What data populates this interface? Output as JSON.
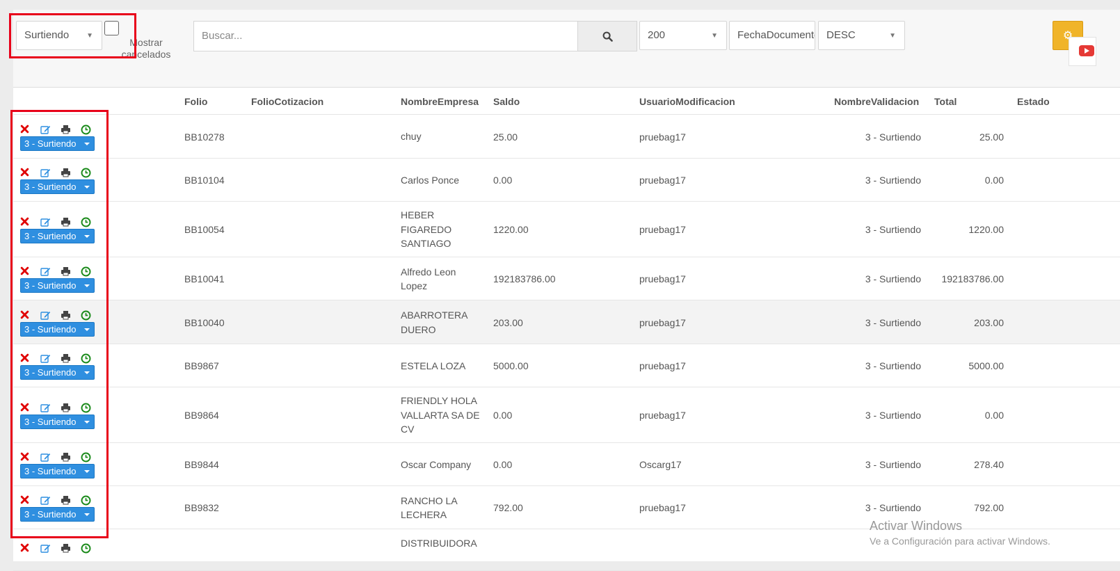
{
  "toolbar": {
    "status_filter": "Surtiendo",
    "show_canceled_line1": "Mostrar",
    "show_canceled_line2": "cancelados",
    "search_placeholder": "Buscar...",
    "page_size": "200",
    "sort_field": "FechaDocumento",
    "sort_order": "DESC"
  },
  "columns": {
    "folio": "Folio",
    "folio_cotizacion": "FolioCotizacion",
    "nombre_empresa": "NombreEmpresa",
    "saldo": "Saldo",
    "usuario": "UsuarioModificacion",
    "validacion": "NombreValidacion",
    "total": "Total",
    "estado": "Estado"
  },
  "rows": [
    {
      "status": "3 - Surtiendo",
      "folio": "BB10278",
      "empresa": [
        "chuy"
      ],
      "saldo": "25.00",
      "usuario": "pruebag17",
      "validacion": "3 - Surtiendo",
      "total": "25.00"
    },
    {
      "status": "3 - Surtiendo",
      "folio": "BB10104",
      "empresa": [
        "Carlos Ponce"
      ],
      "saldo": "0.00",
      "usuario": "pruebag17",
      "validacion": "3 - Surtiendo",
      "total": "0.00"
    },
    {
      "status": "3 - Surtiendo",
      "folio": "BB10054",
      "empresa": [
        "HEBER",
        "FIGAREDO",
        "SANTIAGO"
      ],
      "saldo": "1220.00",
      "usuario": "pruebag17",
      "validacion": "3 - Surtiendo",
      "total": "1220.00"
    },
    {
      "status": "3 - Surtiendo",
      "folio": "BB10041",
      "empresa": [
        "Alfredo Leon",
        "Lopez"
      ],
      "saldo": "192183786.00",
      "usuario": "pruebag17",
      "validacion": "3 - Surtiendo",
      "total": "192183786.00"
    },
    {
      "status": "3 - Surtiendo",
      "folio": "BB10040",
      "empresa": [
        "ABARROTERA",
        "DUERO"
      ],
      "saldo": "203.00",
      "usuario": "pruebag17",
      "validacion": "3 - Surtiendo",
      "total": "203.00"
    },
    {
      "status": "3 - Surtiendo",
      "folio": "BB9867",
      "empresa": [
        "ESTELA LOZA"
      ],
      "saldo": "5000.00",
      "usuario": "pruebag17",
      "validacion": "3 - Surtiendo",
      "total": "5000.00"
    },
    {
      "status": "3 - Surtiendo",
      "folio": "BB9864",
      "empresa": [
        "FRIENDLY HOLA",
        "VALLARTA SA DE",
        "CV"
      ],
      "saldo": "0.00",
      "usuario": "pruebag17",
      "validacion": "3 - Surtiendo",
      "total": "0.00"
    },
    {
      "status": "3 - Surtiendo",
      "folio": "BB9844",
      "empresa": [
        "Oscar Company"
      ],
      "saldo": "0.00",
      "usuario": "Oscarg17",
      "validacion": "3 - Surtiendo",
      "total": "278.40"
    },
    {
      "status": "3 - Surtiendo",
      "folio": "BB9832",
      "empresa": [
        "RANCHO LA",
        "LECHERA"
      ],
      "saldo": "792.00",
      "usuario": "pruebag17",
      "validacion": "3 - Surtiendo",
      "total": "792.00"
    },
    {
      "status": "",
      "folio": "",
      "empresa": [
        "DISTRIBUIDORA"
      ],
      "saldo": "",
      "usuario": "",
      "validacion": "",
      "total": ""
    }
  ],
  "watermark": {
    "title": "Activar Windows",
    "subtitle": "Ve a Configuración para activar Windows."
  },
  "colors": {
    "accent": "#2f8fe0",
    "delete": "#e00000",
    "history": "#1a8a1a",
    "highlight_box": "#e8001a",
    "gear_button": "#f0b429"
  },
  "icons": [
    "delete-icon",
    "edit-icon",
    "print-icon",
    "history-icon",
    "search-icon",
    "gear-icon",
    "youtube-icon"
  ]
}
